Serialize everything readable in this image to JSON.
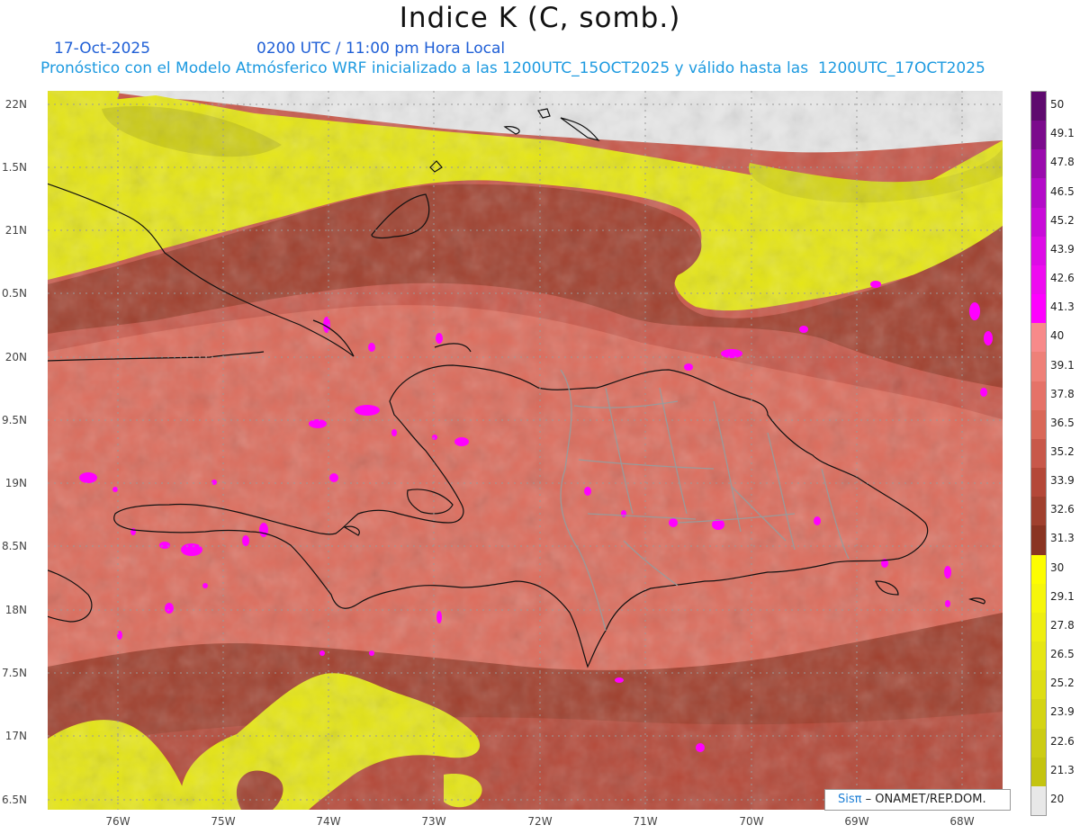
{
  "header": {
    "title": "Indice K (C, somb.)",
    "date": "17-Oct-2025",
    "time": "0200 UTC / 11:00 pm Hora Local",
    "subtitle": "Pronóstico con el Modelo Atmósferico WRF inicializado a las 1200UTC_15OCT2025 y válido hasta las  1200UTC_17OCT2025"
  },
  "map": {
    "lat_labels": [
      "22N",
      "1.5N",
      "21N",
      "0.5N",
      "20N",
      "9.5N",
      "19N",
      "8.5N",
      "18N",
      "7.5N",
      "17N",
      "6.5N"
    ],
    "lon_labels": [
      "76W",
      "75W",
      "74W",
      "73W",
      "72W",
      "71W",
      "70W",
      "69W",
      "68W"
    ],
    "colors": {
      "land_outline": "#111111",
      "province_outline": "#9a9a9a",
      "no_data": "#e8e8e8",
      "grid": "#9a9a9a"
    }
  },
  "colorbar": {
    "labels": [
      "50",
      "49.1",
      "47.8",
      "46.5",
      "45.2",
      "43.9",
      "42.6",
      "41.3",
      "40",
      "39.1",
      "37.8",
      "36.5",
      "35.2",
      "33.9",
      "32.6",
      "31.3",
      "30",
      "29.1",
      "27.8",
      "26.5",
      "25.2",
      "23.9",
      "22.6",
      "21.3",
      "20"
    ],
    "colors": [
      "#5e0a6e",
      "#7b0a8c",
      "#9a0aad",
      "#b30ac8",
      "#c80ad8",
      "#dd0ae6",
      "#ee0af0",
      "#ff00ff",
      "#f78a8a",
      "#ee8078",
      "#e57268",
      "#d96858",
      "#c8584a",
      "#b44838",
      "#a0402e",
      "#8a3422",
      "#fdfd00",
      "#f6f60a",
      "#eeee10",
      "#e6e614",
      "#dede14",
      "#d4d414",
      "#cccc14",
      "#c4c410",
      "#e8e8e8"
    ]
  },
  "footer": {
    "logo_sis": "Sisπ",
    "logo_text": " – ONAMET/REP.DOM."
  }
}
